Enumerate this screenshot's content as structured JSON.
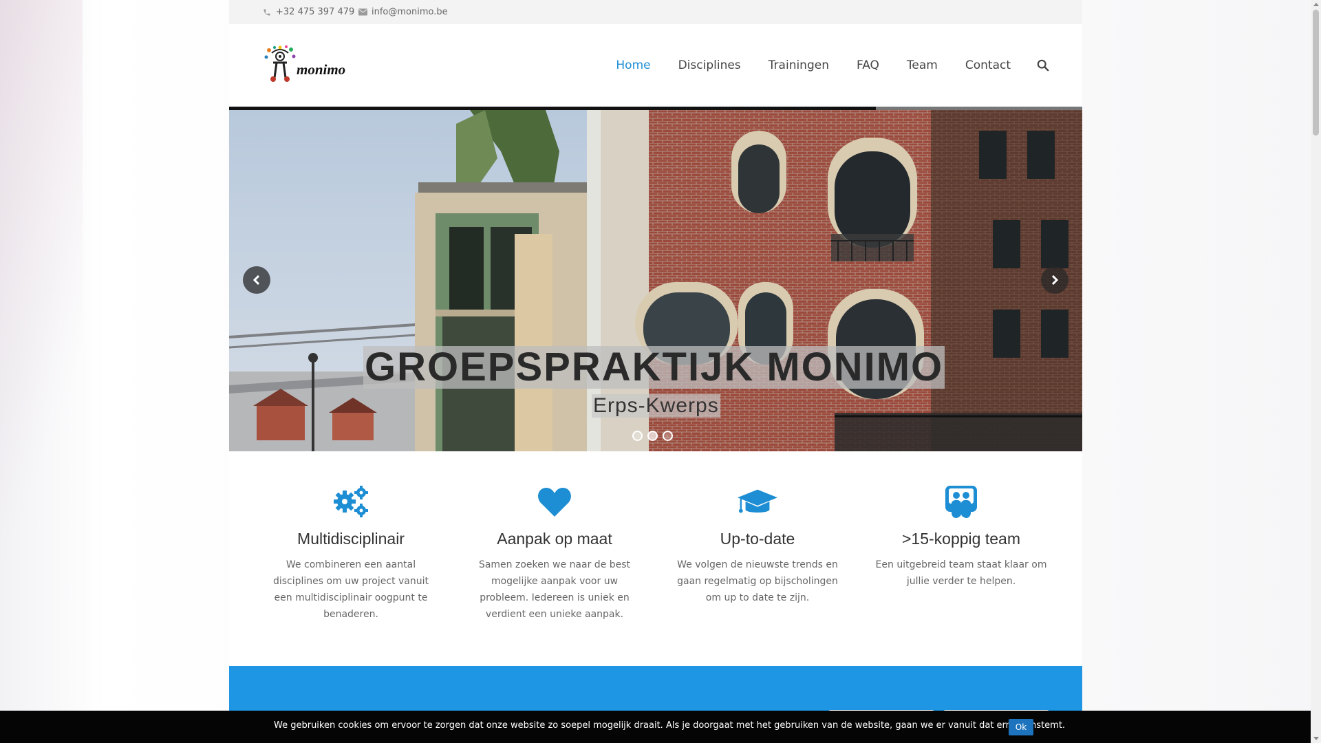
{
  "topbar": {
    "phone": "+32 475 397 479",
    "email": "info@monimo.be",
    "phone_icon": "phone-icon",
    "email_icon": "envelope-icon"
  },
  "brand": {
    "logo_text": "monimo"
  },
  "nav": {
    "items": [
      "Home",
      "Disciplines",
      "Trainingen",
      "FAQ",
      "Team",
      "Contact"
    ],
    "active": "Home",
    "search_icon": "search-icon"
  },
  "hero": {
    "title": "GROEPSPRAKTIJK MONIMO",
    "subtitle": "Erps-Kwerps",
    "slides": 3,
    "active_slide": 2
  },
  "features": [
    {
      "icon": "gears-icon",
      "title": "Multidisciplinair",
      "text": "We combineren een aantal disciplines om uw project vanuit een multidisciplinair oogpunt te benaderen."
    },
    {
      "icon": "heart-icon",
      "title": "Aanpak op maat",
      "text": "Samen zoeken we naar de best mogelijke aanpak voor uw probleem. Iedereen is uniek en verdient een unieke aanpak."
    },
    {
      "icon": "graduation-cap-icon",
      "title": "Up-to-date",
      "text": "We volgen de nieuwste trends en gaan regelmatig op bijscholingen om up to date te zijn."
    },
    {
      "icon": "team-icon",
      "title": ">15-koppig team",
      "text": "Een uitgebreid team staat klaar om jullie verder te helpen."
    }
  ],
  "cookie": {
    "message": "We gebruiken cookies om ervoor te zorgen dat onze website zo soepel mogelijk draait. Als je doorgaat met het gebruiken van de website, gaan we er vanuit dat ermee instemt.",
    "ok_label": "Ok"
  },
  "colors": {
    "accent": "#1e96e3",
    "nav_active": "#1e8ed4",
    "cookie_bg": "#050505"
  }
}
